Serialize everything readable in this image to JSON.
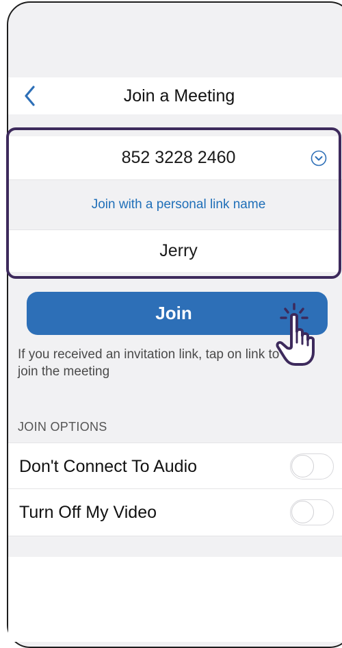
{
  "header": {
    "title": "Join a Meeting",
    "back_icon": "chevron-left-icon"
  },
  "form": {
    "meeting_id_value": "852 3228 2460",
    "dropdown_icon": "chevron-down-circle-icon",
    "personal_link_label": "Join with a personal link name",
    "name_value": "Jerry"
  },
  "join_button": {
    "label": "Join"
  },
  "hint": {
    "text": "If you received an invitation link, tap on link to join the meeting"
  },
  "join_options": {
    "section_label": "JOIN OPTIONS",
    "options": [
      {
        "label": "Don't Connect To Audio",
        "enabled": false
      },
      {
        "label": "Turn Off My Video",
        "enabled": false
      }
    ]
  },
  "colors": {
    "accent": "#2d6fb7",
    "link": "#1f6fb8",
    "highlight_border": "#3d2a5c",
    "background": "#f1f1f3"
  },
  "annotation": {
    "pointer_icon": "hand-pointer-icon"
  }
}
